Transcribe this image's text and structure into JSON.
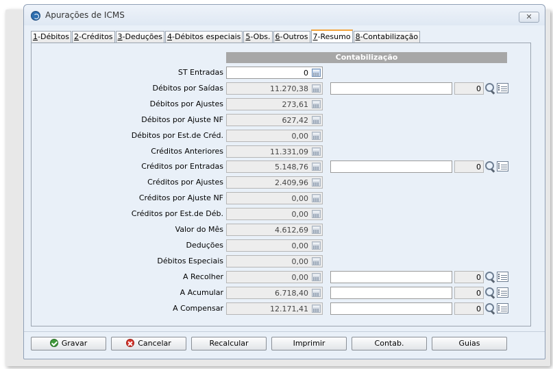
{
  "window": {
    "title": "Apurações de ICMS",
    "close_label": "✕"
  },
  "tabs": [
    {
      "key": "1",
      "label": "-Débitos",
      "active": false
    },
    {
      "key": "2",
      "label": "-Créditos",
      "active": false
    },
    {
      "key": "3",
      "label": "-Deduções",
      "active": false
    },
    {
      "key": "4",
      "label": "-Débitos especiais",
      "active": false
    },
    {
      "key": "5",
      "label": "-Obs.",
      "active": false
    },
    {
      "key": "6",
      "label": "-Outros",
      "active": false
    },
    {
      "key": "7",
      "label": "-Resumo",
      "active": true
    },
    {
      "key": "8",
      "label": "-Contabilização",
      "active": false
    }
  ],
  "section_header": "Contabilização",
  "rows": [
    {
      "label": "ST Entradas",
      "value": "0",
      "editable": true
    },
    {
      "label": "Débitos por Saídas",
      "value": "11.270,38",
      "editable": false,
      "account": "",
      "account_number": "0"
    },
    {
      "label": "Débitos por Ajustes",
      "value": "273,61",
      "editable": false
    },
    {
      "label": "Débitos por Ajuste NF",
      "value": "627,42",
      "editable": false
    },
    {
      "label": "Débitos por Est.de Créd.",
      "value": "0,00",
      "editable": false
    },
    {
      "label": "Créditos Anteriores",
      "value": "11.331,09",
      "editable": false
    },
    {
      "label": "Créditos por Entradas",
      "value": "5.148,76",
      "editable": false,
      "account": "",
      "account_number": "0"
    },
    {
      "label": "Créditos por Ajustes",
      "value": "2.409,96",
      "editable": false
    },
    {
      "label": "Créditos por Ajuste NF",
      "value": "0,00",
      "editable": false
    },
    {
      "label": "Créditos por Est.de Déb.",
      "value": "0,00",
      "editable": false
    },
    {
      "label": "Valor do Mês",
      "value": "4.612,69",
      "editable": false
    },
    {
      "label": "Deduções",
      "value": "0,00",
      "editable": false
    },
    {
      "label": "Débitos Especiais",
      "value": "0,00",
      "editable": false
    },
    {
      "label": "A Recolher",
      "value": "0,00",
      "editable": false,
      "account": "",
      "account_number": "0"
    },
    {
      "label": "A Acumular",
      "value": "6.718,40",
      "editable": false,
      "account": "",
      "account_number": "0"
    },
    {
      "label": "A Compensar",
      "value": "12.171,41",
      "editable": false,
      "account": "",
      "account_number": "0"
    }
  ],
  "buttons": {
    "gravar": "Gravar",
    "cancelar": "Cancelar",
    "recalcular": "Recalcular",
    "imprimir": "Imprimir",
    "contab": "Contab.",
    "guias": "Guias"
  },
  "icons": {
    "app": "icms-app-icon",
    "calc": "calculator-icon",
    "search": "search-icon",
    "list": "list-icon",
    "save": "check-icon",
    "cancel": "cancel-icon"
  },
  "colors": {
    "window_bg": "#e9f0f8",
    "section_header_bg": "#a7a7a7",
    "active_tab_accent": "#f3a33a",
    "save_green": "#3f9a3a",
    "cancel_red": "#d8342b"
  }
}
